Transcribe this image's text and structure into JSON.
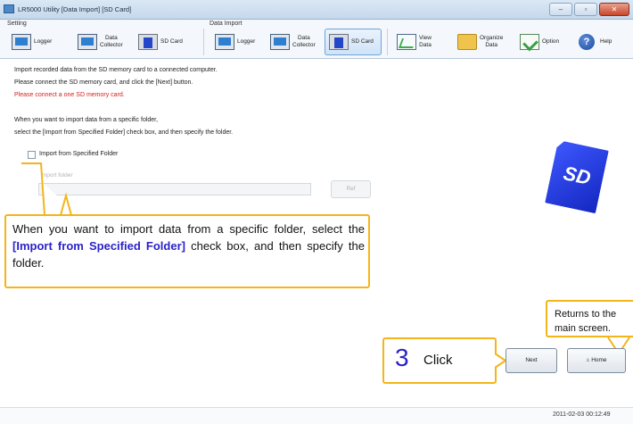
{
  "window": {
    "title": "LR5000 Utility [Data Import] [SD Card]",
    "buttons": [
      "–",
      "▫",
      "✕"
    ]
  },
  "toolbar": {
    "setting_label": "Setting",
    "data_import_label": "Data Import",
    "setting_items": [
      {
        "label": "Logger",
        "icon": "logger-icon"
      },
      {
        "label": "Data\nCollector",
        "icon": "data-collector-icon"
      },
      {
        "label": "SD Card",
        "icon": "sd-card-icon"
      }
    ],
    "import_items": [
      {
        "label": "Logger",
        "icon": "logger-icon"
      },
      {
        "label": "Data\nCollector",
        "icon": "data-collector-icon"
      },
      {
        "label": "SD Card",
        "icon": "sd-card-icon",
        "selected": true
      }
    ],
    "other_items": [
      {
        "label": "View\nData",
        "icon": "view-data-icon"
      },
      {
        "label": "Organize\nData",
        "icon": "organize-data-icon"
      },
      {
        "label": "Option",
        "icon": "option-icon"
      },
      {
        "label": "Help",
        "icon": "help-icon"
      }
    ]
  },
  "content": {
    "intro_1": "Import recorded data from the SD memory card to a connected computer.",
    "intro_2": "Please connect the SD memory card, and click the [Next] button.",
    "warning": "Please connect a one SD memory card.",
    "folder_hint_1": "When you want to import data from a specific folder,",
    "folder_hint_2": "select the [Import from Specified Folder] check box, and then specify the folder.",
    "checkbox_label": "Import from Specified Folder",
    "folder_label": "Import folder",
    "folder_value": "",
    "browse_label": "Ref"
  },
  "callouts": {
    "main_text_1": "When you want to import data from a specific folder, select the ",
    "main_text_bold": "[Import from Specified Folder]",
    "main_text_2": " check box, and then specify the folder.",
    "home_text_1": "Returns to the",
    "home_text_2": "main screen.",
    "step_number": "3",
    "step_text": "Click"
  },
  "buttons": {
    "next_label": "Next",
    "home_label": "Home"
  },
  "status": {
    "timestamp": "2011-02-03 00:12:49"
  },
  "colors": {
    "callout_border": "#f4b51a",
    "callout_accent": "#2a22c9",
    "warning_red": "#d62020",
    "sd_blue": "#1327c0"
  }
}
